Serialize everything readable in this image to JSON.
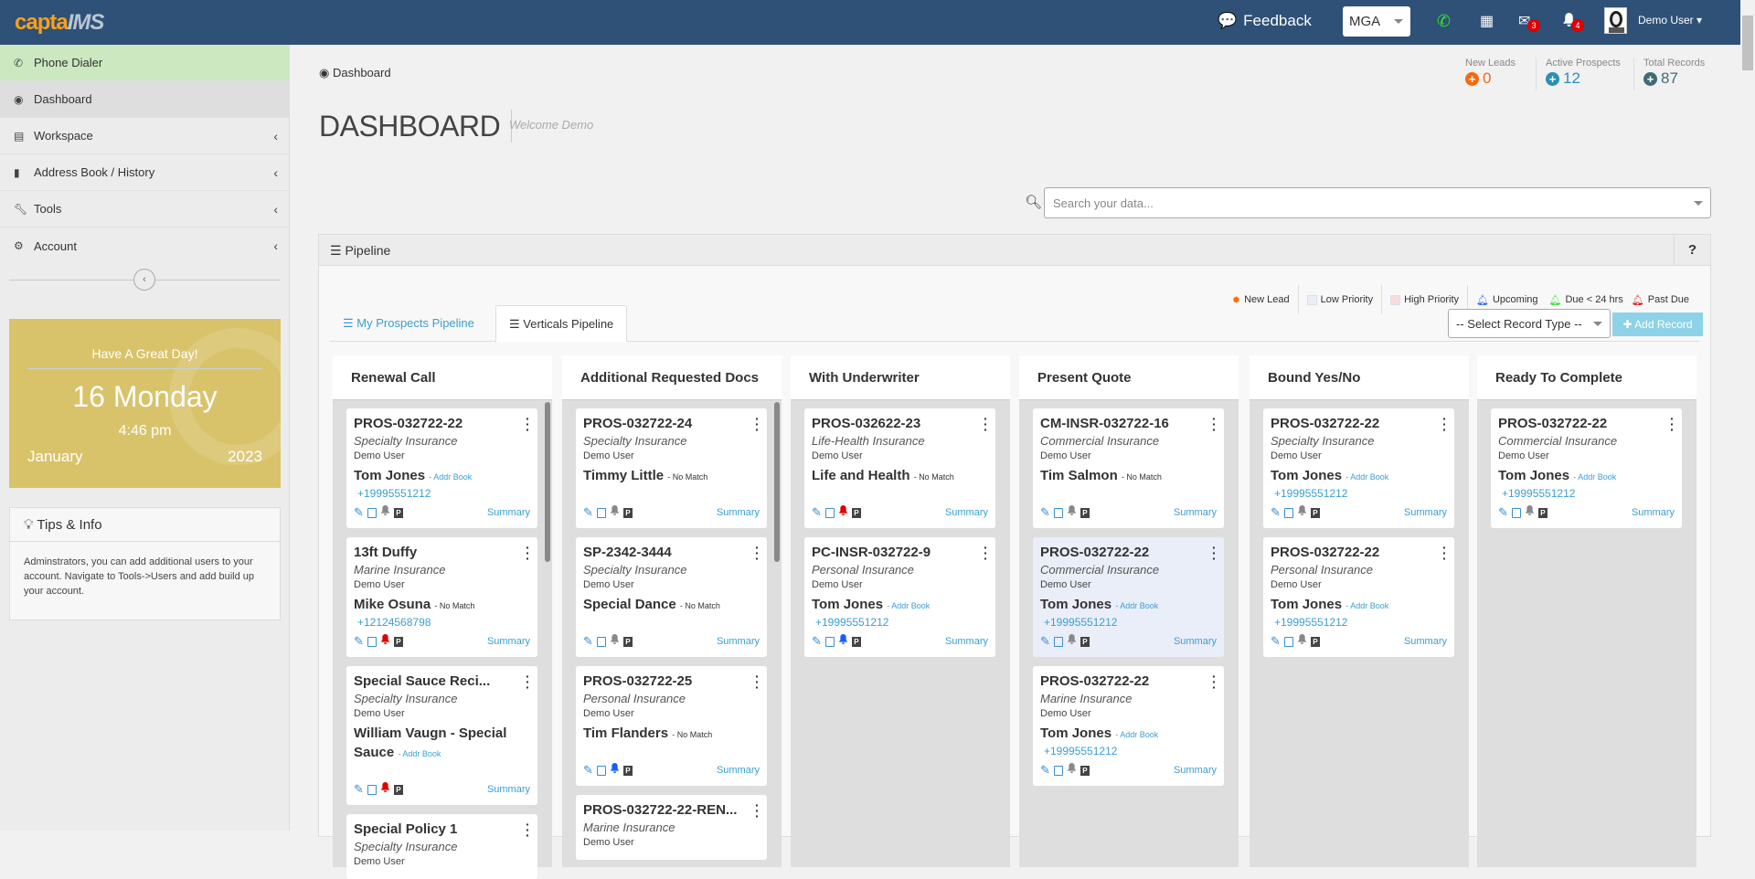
{
  "topbar": {
    "logo_a": "capta",
    "logo_b": "IMS",
    "feedback": "Feedback",
    "org_select": "MGA",
    "mail_count": "3",
    "notif_count": "4",
    "user": "Demo User"
  },
  "sidebar": {
    "items": [
      {
        "label": "Phone Dialer",
        "icon": "phone-icon"
      },
      {
        "label": "Dashboard",
        "icon": "dashboard-icon"
      },
      {
        "label": "Workspace",
        "icon": "clipboard-icon"
      },
      {
        "label": "Address Book / History",
        "icon": "book-icon"
      },
      {
        "label": "Tools",
        "icon": "wrench-icon"
      },
      {
        "label": "Account",
        "icon": "gear-icon"
      }
    ]
  },
  "date_widget": {
    "greeting": "Have A Great Day!",
    "day": "16 Monday",
    "time": "4:46 pm",
    "month": "January",
    "year": "2023"
  },
  "tips": {
    "title": "Tips & Info",
    "body": "Adminstrators, you can add additional users to your account. Navigate to Tools->Users and add build up your account."
  },
  "breadcrumb": "Dashboard",
  "page": {
    "title": "DASHBOARD",
    "subtitle": "Welcome Demo"
  },
  "stats": [
    {
      "label": "New Leads",
      "value": "0",
      "color": "#f36a10"
    },
    {
      "label": "Active Prospects",
      "value": "12",
      "color": "#2a8fb8"
    },
    {
      "label": "Total Records",
      "value": "87",
      "color": "#3f6b78"
    }
  ],
  "search": {
    "placeholder": "Search your data..."
  },
  "pipeline": {
    "title": "Pipeline",
    "help": "?",
    "legend": {
      "new_lead": "New Lead",
      "low": "Low Priority",
      "high": "High Priority",
      "upcoming": "Upcoming",
      "due": "Due < 24 hrs",
      "past": "Past Due"
    },
    "tabs": [
      "My Prospects Pipeline",
      "Verticals Pipeline"
    ],
    "active_tab": "Verticals Pipeline",
    "record_type": "-- Select Record Type --",
    "add_record": "Add Record",
    "summary_label": "Summary",
    "columns": [
      {
        "title": "Renewal Call",
        "cards": [
          {
            "id": "PROS-032722-22",
            "type": "Specialty Insurance",
            "user": "Demo User",
            "contact": "Tom Jones",
            "match": "Addr Book",
            "phone": "+19995551212",
            "bell": "#888888"
          },
          {
            "id": "13ft Duffy",
            "type": "Marine Insurance",
            "user": "Demo User",
            "contact": "Mike Osuna",
            "match": "No Match",
            "phone": "+12124568798",
            "bell": "#e00000"
          },
          {
            "id": "Special Sauce Reci...",
            "type": "Specialty Insurance",
            "user": "Demo User",
            "contact": "William Vaugn - Special Sauce",
            "match": "Addr Book",
            "phone": "",
            "bell": "#e00000"
          },
          {
            "id": "Special Policy 1",
            "type": "Specialty Insurance",
            "user": "Demo User",
            "contact": "",
            "match": "",
            "phone": "",
            "bell": "#888888"
          }
        ]
      },
      {
        "title": "Additional Requested Docs",
        "cards": [
          {
            "id": "PROS-032722-24",
            "type": "Specialty Insurance",
            "user": "Demo User",
            "contact": "Timmy Little",
            "match": "No Match",
            "phone": "",
            "bell": "#888888"
          },
          {
            "id": "SP-2342-3444",
            "type": "Specialty Insurance",
            "user": "Demo User",
            "contact": "Special Dance",
            "match": "No Match",
            "phone": "",
            "bell": "#888888"
          },
          {
            "id": "PROS-032722-25",
            "type": "Personal Insurance",
            "user": "Demo User",
            "contact": "Tim Flanders",
            "match": "No Match",
            "phone": "",
            "bell": "#1a5cff"
          },
          {
            "id": "PROS-032722-22-REN...",
            "type": "Marine Insurance",
            "user": "Demo User",
            "contact": "",
            "match": "",
            "phone": "",
            "bell": "#888888"
          }
        ]
      },
      {
        "title": "With Underwriter",
        "cards": [
          {
            "id": "PROS-032622-23",
            "type": "Life-Health Insurance",
            "user": "Demo User",
            "contact": "Life and Health",
            "match": "No Match",
            "phone": "",
            "bell": "#e00000"
          },
          {
            "id": "PC-INSR-032722-9",
            "type": "Personal Insurance",
            "user": "Demo User",
            "contact": "Tom Jones",
            "match": "Addr Book",
            "phone": "+19995551212",
            "bell": "#1a5cff"
          }
        ]
      },
      {
        "title": "Present Quote",
        "cards": [
          {
            "id": "CM-INSR-032722-16",
            "type": "Commercial Insurance",
            "user": "Demo User",
            "contact": "Tim Salmon",
            "match": "No Match",
            "phone": "",
            "bell": "#888888"
          },
          {
            "id": "PROS-032722-22",
            "type": "Commercial Insurance",
            "user": "Demo User",
            "contact": "Tom Jones",
            "match": "Addr Book",
            "phone": "+19995551212",
            "bell": "#888888",
            "low_priority": true
          },
          {
            "id": "PROS-032722-22",
            "type": "Marine Insurance",
            "user": "Demo User",
            "contact": "Tom Jones",
            "match": "Addr Book",
            "phone": "+19995551212",
            "bell": "#888888"
          }
        ]
      },
      {
        "title": "Bound Yes/No",
        "cards": [
          {
            "id": "PROS-032722-22",
            "type": "Specialty Insurance",
            "user": "Demo User",
            "contact": "Tom Jones",
            "match": "Addr Book",
            "phone": "+19995551212",
            "bell": "#888888"
          },
          {
            "id": "PROS-032722-22",
            "type": "Personal Insurance",
            "user": "Demo User",
            "contact": "Tom Jones",
            "match": "Addr Book",
            "phone": "+19995551212",
            "bell": "#888888"
          }
        ]
      },
      {
        "title": "Ready To Complete",
        "cards": [
          {
            "id": "PROS-032722-22",
            "type": "Commercial Insurance",
            "user": "Demo User",
            "contact": "Tom Jones",
            "match": "Addr Book",
            "phone": "+19995551212",
            "bell": "#888888"
          }
        ]
      }
    ]
  }
}
